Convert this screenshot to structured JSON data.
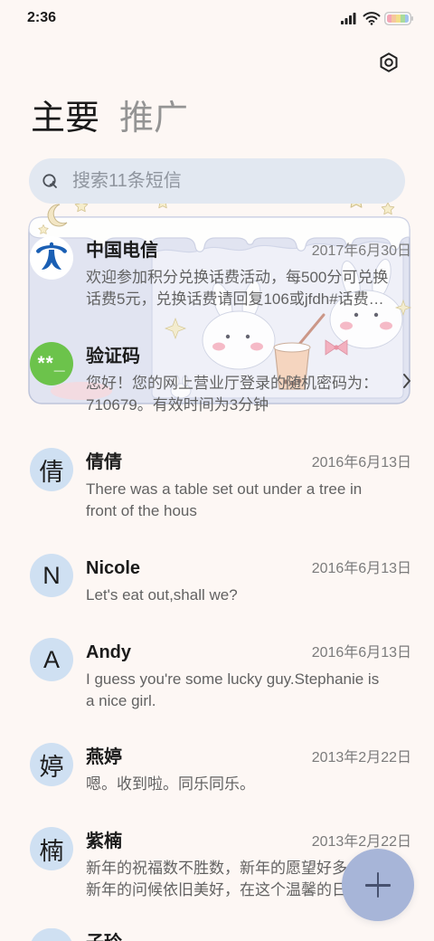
{
  "status_bar": {
    "time": "2:36",
    "icons": [
      "signal-icon",
      "wifi-icon",
      "battery-icon"
    ]
  },
  "header": {
    "settings_icon": "settings-icon",
    "tabs": [
      {
        "label": "主要",
        "active": true
      },
      {
        "label": "推广",
        "active": false
      }
    ]
  },
  "search": {
    "placeholder": "搜索11条短信",
    "icon": "search-icon"
  },
  "colors": {
    "background": "#fdf7f4",
    "search_bg": "#e2e8f1",
    "avatar_bg": "#cfe0f2",
    "verification_avatar": "#6cc34b",
    "fab": "#a7b5d8",
    "telecom_blue": "#1a5fb4"
  },
  "conversations": [
    {
      "avatar": {
        "icon": "china-telecom-logo"
      },
      "name": "中国电信",
      "date": "2017年6月30日",
      "preview": [
        "欢迎参加积分兑换话费活动，每500分可兑换",
        "话费5元，兑换话费请回复106或jfdh#话费…"
      ]
    },
    {
      "avatar": {
        "text": "**_"
      },
      "name": "验证码",
      "preview": [
        "您好！您的网上营业厅登录的随机密码为：",
        "710679。有效时间为3分钟"
      ]
    },
    {
      "avatar": {
        "text": "倩"
      },
      "name": "倩倩",
      "date": "2016年6月13日",
      "preview": [
        "There was a table set out under a tree in",
        "front of the hous"
      ]
    },
    {
      "avatar": {
        "text": "N"
      },
      "name": "Nicole",
      "date": "2016年6月13日",
      "preview": [
        "Let's eat out,shall we?"
      ]
    },
    {
      "avatar": {
        "text": "A"
      },
      "name": "Andy",
      "date": "2016年6月13日",
      "preview": [
        "I guess you're some lucky guy.Stephanie is",
        "a nice girl."
      ]
    },
    {
      "avatar": {
        "text": "婷"
      },
      "name": "燕婷",
      "date": "2013年2月22日",
      "preview": [
        "嗯。收到啦。同乐同乐。"
      ]
    },
    {
      "avatar": {
        "text": "楠"
      },
      "name": "紫楠",
      "date": "2013年2月22日",
      "preview": [
        "新年的祝福数不胜数，新年的愿望好多",
        "新年的问候依旧美好，在这个温馨的日"
      ]
    },
    {
      "name": "子玲"
    }
  ],
  "banner": {
    "icons": [
      "moon-icon",
      "star-icon",
      "bunny-illustration",
      "drink-cup-illustration",
      "bow-icon"
    ]
  },
  "fab": {
    "icon": "plus-icon"
  }
}
